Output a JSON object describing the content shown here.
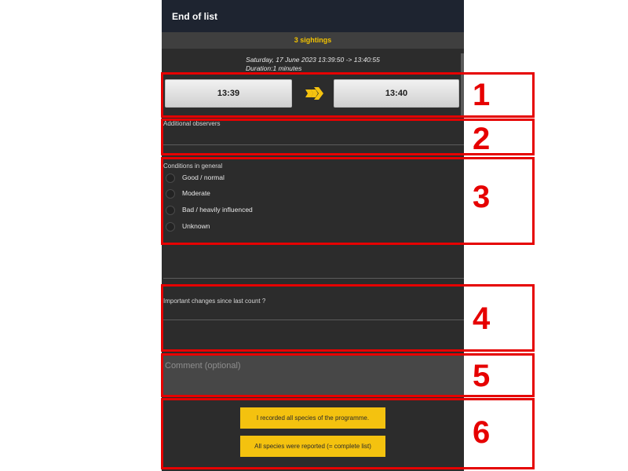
{
  "header": {
    "title": "End of list"
  },
  "sightings": {
    "label": "3 sightings"
  },
  "session": {
    "date_range": "Saturday, 17 June 2023 13:39:50 -> 13:40:55",
    "duration": "Duration:1 minutes"
  },
  "times": {
    "start": "13:39",
    "end": "13:40"
  },
  "observers": {
    "label": "Additional observers",
    "value": ""
  },
  "conditions": {
    "label": "Conditions in general",
    "options": [
      "Good / normal",
      "Moderate",
      "Bad / heavily influenced",
      "Unknown"
    ]
  },
  "changes": {
    "label": "Important changes since last count ?",
    "value": ""
  },
  "comment": {
    "placeholder": "Comment (optional)"
  },
  "actions": {
    "all_species_recorded": "I recorded all species of the programme.",
    "complete_list": "All species were reported (= complete list)"
  },
  "annotations": [
    "1",
    "2",
    "3",
    "4",
    "5",
    "6"
  ],
  "colors": {
    "accent": "#f4c20f",
    "annotation": "#e60000",
    "header_bg": "#1e2430",
    "panel_bg": "#2c2c2c"
  }
}
